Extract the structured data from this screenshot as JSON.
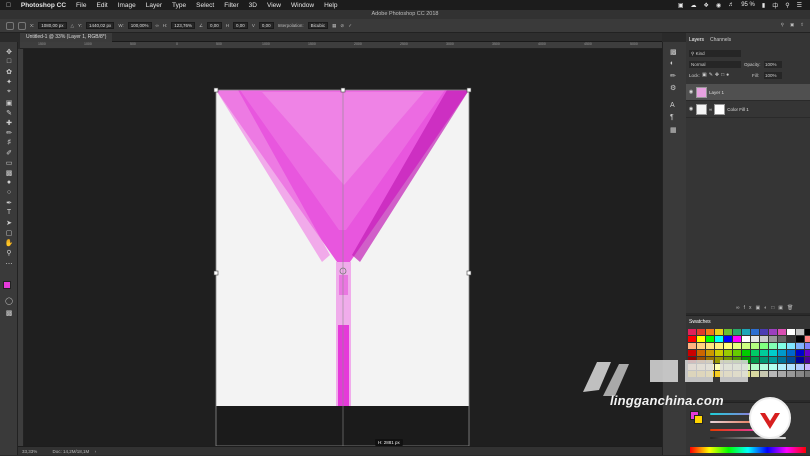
{
  "menubar": {
    "app": "Photoshop CC",
    "items": [
      "File",
      "Edit",
      "Image",
      "Layer",
      "Type",
      "Select",
      "Filter",
      "3D",
      "View",
      "Window",
      "Help"
    ],
    "battery": "95 %",
    "flag": "中"
  },
  "window": {
    "title": "Adobe Photoshop CC 2018"
  },
  "options": {
    "x_label": "X:",
    "x_value": "1080,00 px",
    "y_label": "Y:",
    "y_value": "1440,02 px",
    "w_label": "W:",
    "w_value": "100,00%",
    "h_label": "H:",
    "h_value": "123,76%",
    "angle_value": "0,00",
    "h2_value": "0,00",
    "v_value": "0,00",
    "interp_label": "Interpolation:",
    "interp_value": "Bicubic"
  },
  "document": {
    "tab_label": "Untitled-1 @ 33% (Layer 1, RGB/8*)"
  },
  "ruler": {
    "top_ticks": [
      "1500",
      "1000",
      "500",
      "0",
      "500",
      "1000",
      "1500",
      "2000",
      "2500",
      "3000",
      "3500",
      "4000",
      "4500",
      "5000"
    ]
  },
  "status": {
    "zoom": "33,33%",
    "doc": "Doc: 14,2M/18,1M"
  },
  "measure": {
    "label": "H: 2881 px"
  },
  "layers": {
    "tabs": [
      "Layers",
      "Channels"
    ],
    "kind_label": "Kind",
    "blend_mode": "Normal",
    "opacity_label": "Opacity:",
    "opacity_value": "100%",
    "lock_label": "Lock:",
    "fill_label": "Fill:",
    "fill_value": "100%",
    "items": [
      {
        "name": "Layer 1"
      },
      {
        "name": "Color Fill 1"
      }
    ]
  },
  "swatches": {
    "title": "Swatches",
    "colors": [
      "#e0205a",
      "#e03a2c",
      "#f27a1a",
      "#e8d21a",
      "#6bbf2f",
      "#28a86b",
      "#1da6b8",
      "#2d6ed1",
      "#4b3bb3",
      "#9c3fbf",
      "#d94fb2",
      "#ffffff",
      "#c0c0c0",
      "#000000",
      "#ff0000",
      "#ffff00",
      "#00ff00",
      "#00ffff",
      "#0000ff",
      "#ff00ff",
      "#ffffff",
      "#e6e6e6",
      "#cccccc",
      "#999999",
      "#666666",
      "#333333",
      "#000000",
      "#ff8080",
      "#ffb380",
      "#ffd280",
      "#ffe680",
      "#fff280",
      "#ffff80",
      "#e6ff80",
      "#ccff80",
      "#b3ff80",
      "#80ff80",
      "#80ffb3",
      "#80ffe6",
      "#80e6ff",
      "#80b3ff",
      "#8080ff",
      "#cc0000",
      "#cc6600",
      "#cc9900",
      "#cccc00",
      "#99cc00",
      "#66cc00",
      "#00cc00",
      "#00cc66",
      "#00cc99",
      "#00cccc",
      "#0099cc",
      "#0066cc",
      "#0000cc",
      "#6600cc",
      "#990000",
      "#994c00",
      "#997300",
      "#999900",
      "#739900",
      "#4c9900",
      "#009900",
      "#00994c",
      "#009973",
      "#009999",
      "#007399",
      "#004c99",
      "#000099",
      "#4c0099",
      "#ffcc99",
      "#ffe0a3",
      "#fff0b3",
      "#ffffb3",
      "#f0ffb3",
      "#e0ffb3",
      "#ccffb3",
      "#b3ffcc",
      "#b3ffe0",
      "#b3fff0",
      "#b3f0ff",
      "#b3e0ff",
      "#b3ccff",
      "#ccb3ff",
      "#d4aa00",
      "#e0b000",
      "#f0c000",
      "#f5cc22",
      "#f0d040",
      "#e8d860",
      "#e0e080",
      "#d8d8a0",
      "#c8c8b0",
      "#b8b8b8",
      "#a8a8a8",
      "#989898",
      "#888888",
      "#787878"
    ]
  },
  "colorpanel": {
    "fg": "#e53ad9",
    "bg": "#ffd400"
  },
  "watermark": {
    "site": "lingganchina.com"
  },
  "accent": {
    "pink": "#e53ad9"
  }
}
